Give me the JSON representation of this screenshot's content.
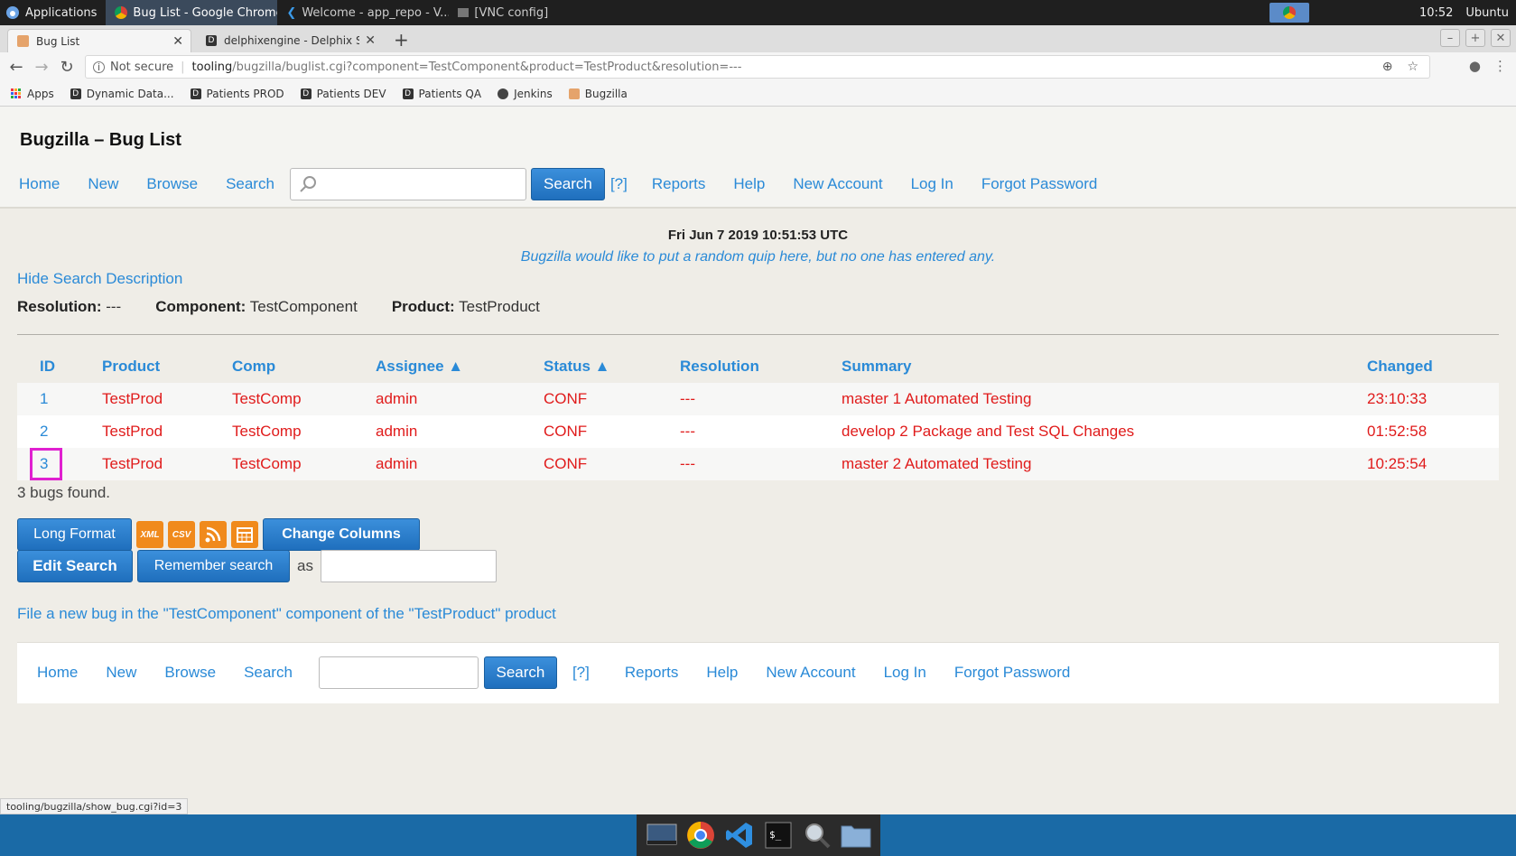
{
  "os_panel": {
    "applications_label": "Applications",
    "tasks": [
      {
        "label": "Bug List - Google Chrome",
        "active": true
      },
      {
        "label": "Welcome - app_repo - V...",
        "active": false
      },
      {
        "label": "[VNC config]",
        "active": false
      }
    ],
    "clock": "10:52",
    "user": "Ubuntu"
  },
  "browser": {
    "tabs": [
      {
        "label": "Bug List",
        "active": true
      },
      {
        "label": "delphixengine - Delphix Se",
        "active": false
      }
    ],
    "address": {
      "security": "Not secure",
      "host": "tooling",
      "path": "/bugzilla/buglist.cgi?component=TestComponent&product=TestProduct&resolution=---"
    },
    "bookmarks": [
      {
        "label": "Apps",
        "icon": "apps-grid-icon"
      },
      {
        "label": "Dynamic Data...",
        "icon": "d-icon"
      },
      {
        "label": "Patients PROD",
        "icon": "d-icon"
      },
      {
        "label": "Patients DEV",
        "icon": "d-icon"
      },
      {
        "label": "Patients QA",
        "icon": "d-icon"
      },
      {
        "label": "Jenkins",
        "icon": "jenkins-icon"
      },
      {
        "label": "Bugzilla",
        "icon": "bugzilla-icon"
      }
    ],
    "status_url": "tooling/bugzilla/show_bug.cgi?id=3"
  },
  "page": {
    "title": "Bugzilla – Bug List",
    "nav": {
      "home": "Home",
      "new": "New",
      "browse": "Browse",
      "search": "Search",
      "search_button": "Search",
      "help_bracket": "[?]",
      "reports": "Reports",
      "help": "Help",
      "new_account": "New Account",
      "log_in": "Log In",
      "forgot_password": "Forgot Password"
    },
    "date": "Fri Jun 7 2019 10:51:53 UTC",
    "quip": "Bugzilla would like to put a random quip here, but no one has entered any.",
    "hide_search_description": "Hide Search Description",
    "criteria": [
      {
        "label": "Resolution:",
        "value": "---"
      },
      {
        "label": "Component:",
        "value": "TestComponent"
      },
      {
        "label": "Product:",
        "value": "TestProduct"
      }
    ],
    "table": {
      "columns": [
        "ID",
        "Product",
        "Comp",
        "Assignee ▲",
        "Status ▲",
        "Resolution",
        "Summary",
        "Changed"
      ],
      "rows": [
        [
          "1",
          "TestProd",
          "TestComp",
          "admin",
          "CONF",
          "---",
          "master 1 Automated Testing",
          "23:10:33"
        ],
        [
          "2",
          "TestProd",
          "TestComp",
          "admin",
          "CONF",
          "---",
          "develop 2 Package and Test SQL Changes",
          "01:52:58"
        ],
        [
          "3",
          "TestProd",
          "TestComp",
          "admin",
          "CONF",
          "---",
          "master 2 Automated Testing",
          "10:25:54"
        ]
      ]
    },
    "found": "3 bugs found.",
    "actions": {
      "long_format": "Long Format",
      "xml": "XML",
      "csv": "CSV",
      "change_columns": "Change Columns",
      "edit_search": "Edit Search",
      "remember_search": "Remember search",
      "as": "as"
    },
    "file_new_bug": "File a new bug in the \"TestComponent\" component of the \"TestProduct\" product"
  },
  "colors": {
    "link": "#2a8ad7",
    "bug_text": "#e01b1b",
    "button": "#2a7dc9",
    "highlight": "#e020d0"
  }
}
